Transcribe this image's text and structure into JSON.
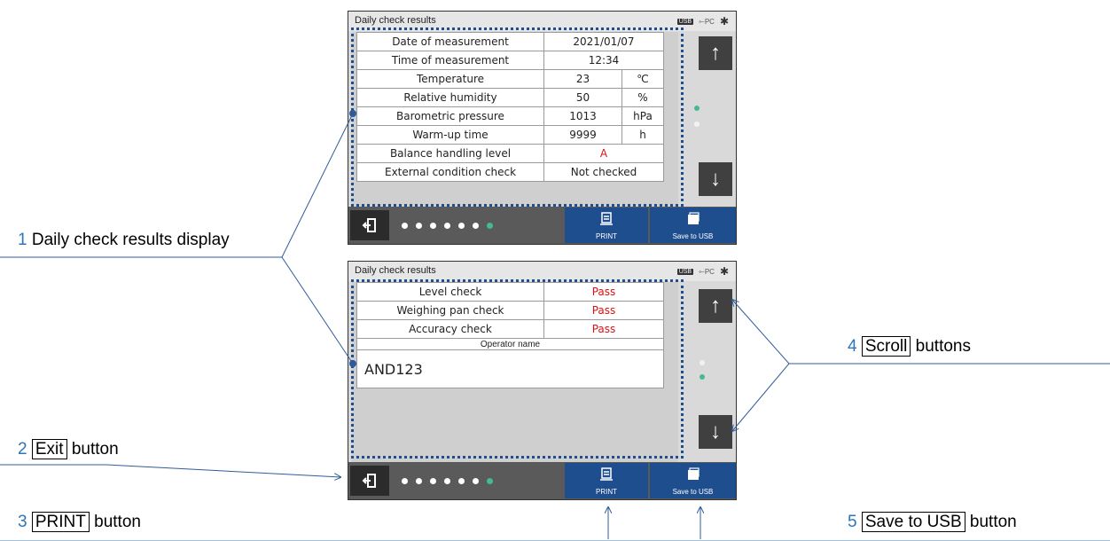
{
  "screen_title": "Daily check results",
  "status": {
    "usb": "USB",
    "pc": "PC",
    "bt": "✱"
  },
  "screen1": {
    "rows": [
      {
        "label": "Date of measurement",
        "value": "2021/01/07",
        "unit": ""
      },
      {
        "label": "Time of measurement",
        "value": "12:34",
        "unit": ""
      },
      {
        "label": "Temperature",
        "value": "23",
        "unit": "℃"
      },
      {
        "label": "Relative humidity",
        "value": "50",
        "unit": "%"
      },
      {
        "label": "Barometric pressure",
        "value": "1013",
        "unit": "hPa"
      },
      {
        "label": "Warm-up time",
        "value": "9999",
        "unit": "h"
      },
      {
        "label": "Balance handling level",
        "value": "A",
        "unit": ""
      },
      {
        "label": "External condition check",
        "value": "Not checked",
        "unit": ""
      }
    ]
  },
  "screen2": {
    "rows": [
      {
        "label": "Level check",
        "value": "Pass"
      },
      {
        "label": "Weighing pan check",
        "value": "Pass"
      },
      {
        "label": "Accuracy check",
        "value": "Pass"
      }
    ],
    "operator_label": "Operator name",
    "operator_value": "AND123"
  },
  "buttons": {
    "print": "PRINT",
    "save": "Save to USB",
    "up_icon": "↑",
    "down_icon": "↓",
    "exit_icon": "exit-icon"
  },
  "callouts": {
    "c1": {
      "num": "1",
      "text": "Daily check results display"
    },
    "c2": {
      "num": "2",
      "boxed": "Exit",
      "text": "button"
    },
    "c3": {
      "num": "3",
      "boxed": "PRINT",
      "text": "button"
    },
    "c4": {
      "num": "4",
      "boxed": "Scroll",
      "text": "buttons"
    },
    "c5": {
      "num": "5",
      "boxed": "Save to USB",
      "text": "button"
    }
  },
  "colors": {
    "accent_blue": "#1e4e8e",
    "callout_number": "#2e75b6",
    "page_dot_active": "#46b98f",
    "fail_red": "#dd1111"
  }
}
